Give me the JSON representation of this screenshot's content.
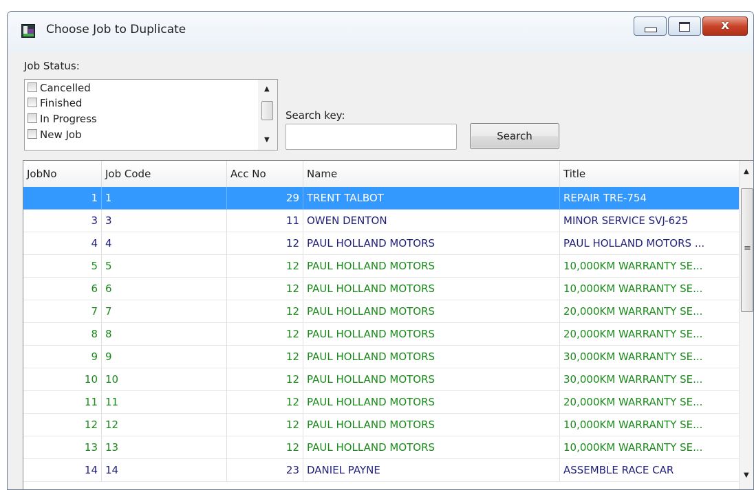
{
  "window": {
    "title": "Choose Job to Duplicate",
    "close_glyph": "x"
  },
  "filters": {
    "job_status_label": "Job Status:",
    "status_options": [
      {
        "label": "Cancelled",
        "checked": false
      },
      {
        "label": "Finished",
        "checked": false
      },
      {
        "label": "In Progress",
        "checked": false
      },
      {
        "label": "New Job",
        "checked": false
      }
    ],
    "search_label": "Search key:",
    "search_value": "",
    "search_button": "Search"
  },
  "grid": {
    "columns": [
      "JobNo",
      "Job Code",
      "Acc No",
      "Name",
      "Title"
    ],
    "rows": [
      {
        "job_no": "1",
        "job_code": "1",
        "acc_no": "29",
        "name": "TRENT TALBOT",
        "title": "REPAIR TRE-754",
        "color": "#1f1f7a",
        "selected": true
      },
      {
        "job_no": "3",
        "job_code": "3",
        "acc_no": "11",
        "name": "OWEN DENTON",
        "title": "MINOR SERVICE SVJ-625",
        "color": "#1f1f7a",
        "selected": false
      },
      {
        "job_no": "4",
        "job_code": "4",
        "acc_no": "12",
        "name": "PAUL HOLLAND MOTORS",
        "title": "PAUL HOLLAND MOTORS ...",
        "color": "#1f1f7a",
        "selected": false
      },
      {
        "job_no": "5",
        "job_code": "5",
        "acc_no": "12",
        "name": "PAUL HOLLAND MOTORS",
        "title": "10,000KM WARRANTY SE...",
        "color": "#1a8a1a",
        "selected": false
      },
      {
        "job_no": "6",
        "job_code": "6",
        "acc_no": "12",
        "name": "PAUL HOLLAND MOTORS",
        "title": "10,000KM WARRANTY SE...",
        "color": "#1a8a1a",
        "selected": false
      },
      {
        "job_no": "7",
        "job_code": "7",
        "acc_no": "12",
        "name": "PAUL HOLLAND MOTORS",
        "title": "20,000KM WARRANTY SE...",
        "color": "#1a8a1a",
        "selected": false
      },
      {
        "job_no": "8",
        "job_code": "8",
        "acc_no": "12",
        "name": "PAUL HOLLAND MOTORS",
        "title": "20,000KM WARRANTY SE...",
        "color": "#1a8a1a",
        "selected": false
      },
      {
        "job_no": "9",
        "job_code": "9",
        "acc_no": "12",
        "name": "PAUL HOLLAND MOTORS",
        "title": "30,000KM WARRANTY SE...",
        "color": "#1a8a1a",
        "selected": false
      },
      {
        "job_no": "10",
        "job_code": "10",
        "acc_no": "12",
        "name": "PAUL HOLLAND MOTORS",
        "title": "30,000KM WARRANTY SE...",
        "color": "#1a8a1a",
        "selected": false
      },
      {
        "job_no": "11",
        "job_code": "11",
        "acc_no": "12",
        "name": "PAUL HOLLAND MOTORS",
        "title": "20,000KM WARRANTY SE...",
        "color": "#1a8a1a",
        "selected": false
      },
      {
        "job_no": "12",
        "job_code": "12",
        "acc_no": "12",
        "name": "PAUL HOLLAND MOTORS",
        "title": "10,000KM WARRANTY SE...",
        "color": "#1a8a1a",
        "selected": false
      },
      {
        "job_no": "13",
        "job_code": "13",
        "acc_no": "12",
        "name": "PAUL HOLLAND MOTORS",
        "title": "10,000KM WARRANTY SE...",
        "color": "#1a8a1a",
        "selected": false
      },
      {
        "job_no": "14",
        "job_code": "14",
        "acc_no": "23",
        "name": "DANIEL PAYNE",
        "title": "ASSEMBLE RACE CAR",
        "color": "#1f1f7a",
        "selected": false
      }
    ]
  }
}
